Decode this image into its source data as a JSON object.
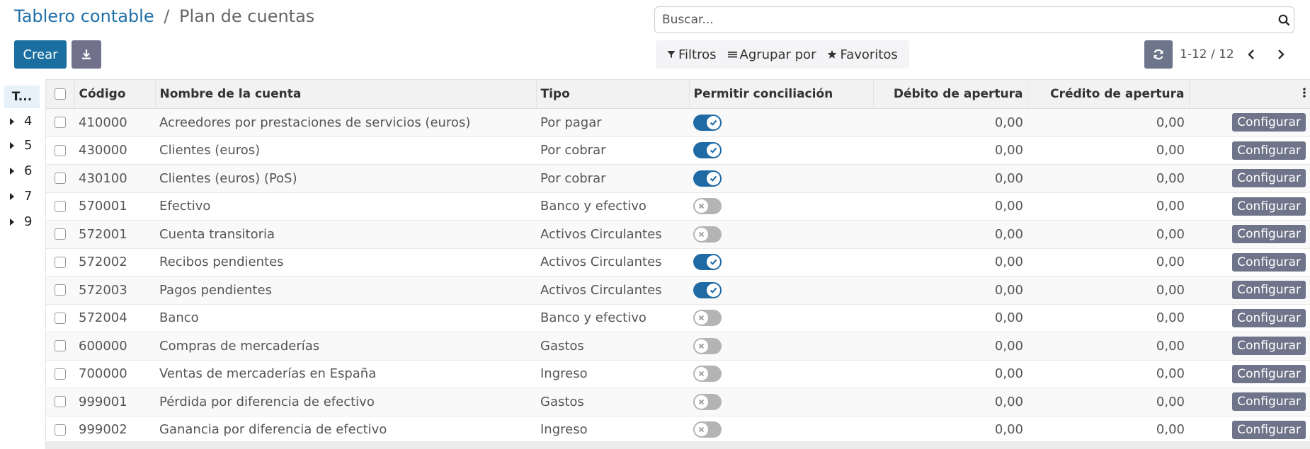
{
  "breadcrumb": {
    "parent": "Tablero contable",
    "separator": "/",
    "current": "Plan de cuentas"
  },
  "toolbar": {
    "create_label": "Crear"
  },
  "search": {
    "placeholder": "Buscar..."
  },
  "filters": {
    "filter_label": "Filtros",
    "group_label": "Agrupar por",
    "favorites_label": "Favoritos"
  },
  "pager": {
    "value": "1-12 / 12"
  },
  "sidepanel": {
    "header": "T...",
    "items": [
      "4",
      "5",
      "6",
      "7",
      "9"
    ]
  },
  "table": {
    "columns": [
      "Código",
      "Nombre de la cuenta",
      "Tipo",
      "Permitir conciliación",
      "Débito de apertura",
      "Crédito de apertura"
    ],
    "action_label": "Configurar",
    "rows": [
      {
        "code": "410000",
        "name": "Acreedores por prestaciones de servicios (euros)",
        "type": "Por pagar",
        "reconcile": true,
        "debit": "0,00",
        "credit": "0,00"
      },
      {
        "code": "430000",
        "name": "Clientes (euros)",
        "type": "Por cobrar",
        "reconcile": true,
        "debit": "0,00",
        "credit": "0,00"
      },
      {
        "code": "430100",
        "name": "Clientes (euros) (PoS)",
        "type": "Por cobrar",
        "reconcile": true,
        "debit": "0,00",
        "credit": "0,00"
      },
      {
        "code": "570001",
        "name": "Efectivo",
        "type": "Banco y efectivo",
        "reconcile": false,
        "debit": "0,00",
        "credit": "0,00"
      },
      {
        "code": "572001",
        "name": "Cuenta transitoria",
        "type": "Activos Circulantes",
        "reconcile": false,
        "debit": "0,00",
        "credit": "0,00"
      },
      {
        "code": "572002",
        "name": "Recibos pendientes",
        "type": "Activos Circulantes",
        "reconcile": true,
        "debit": "0,00",
        "credit": "0,00"
      },
      {
        "code": "572003",
        "name": "Pagos pendientes",
        "type": "Activos Circulantes",
        "reconcile": true,
        "debit": "0,00",
        "credit": "0,00"
      },
      {
        "code": "572004",
        "name": "Banco",
        "type": "Banco y efectivo",
        "reconcile": false,
        "debit": "0,00",
        "credit": "0,00"
      },
      {
        "code": "600000",
        "name": "Compras de mercaderías",
        "type": "Gastos",
        "reconcile": false,
        "debit": "0,00",
        "credit": "0,00"
      },
      {
        "code": "700000",
        "name": "Ventas de mercaderías en España",
        "type": "Ingreso",
        "reconcile": false,
        "debit": "0,00",
        "credit": "0,00"
      },
      {
        "code": "999001",
        "name": "Pérdida por diferencia de efectivo",
        "type": "Gastos",
        "reconcile": false,
        "debit": "0,00",
        "credit": "0,00"
      },
      {
        "code": "999002",
        "name": "Ganancia por diferencia de efectivo",
        "type": "Ingreso",
        "reconcile": false,
        "debit": "0,00",
        "credit": "0,00"
      }
    ]
  },
  "colors": {
    "primary": "#1a6fa0",
    "toggle_on": "#1f6aa5",
    "toggle_off": "#b4b4b4",
    "secondary_button": "#6e7489"
  },
  "icons": {
    "search": "search-icon",
    "download": "download-icon",
    "filter": "filter-icon",
    "group": "group-by-icon",
    "favorites": "star-icon",
    "refresh": "refresh-icon",
    "prev": "chevron-left-icon",
    "next": "chevron-right-icon",
    "optional_columns": "kebab-menu-icon"
  }
}
